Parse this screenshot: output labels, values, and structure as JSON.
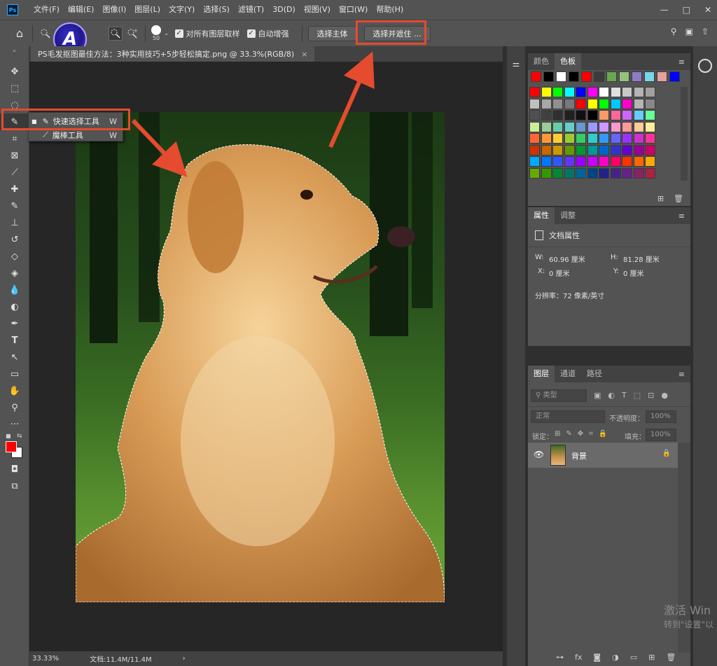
{
  "app": {
    "logo": "Ps"
  },
  "menu": [
    "文件(F)",
    "编辑(E)",
    "图像(I)",
    "图层(L)",
    "文字(Y)",
    "选择(S)",
    "滤镜(T)",
    "3D(D)",
    "视图(V)",
    "窗口(W)",
    "帮助(H)"
  ],
  "window_controls": {
    "minimize": "—",
    "restore": "□",
    "close": "✕"
  },
  "options": {
    "home_icon": "⌂",
    "brush_size": "50",
    "sample_all_layers_label": "对所有图层取样",
    "auto_enhance_label": "自动增强",
    "select_subject_label": "选择主体",
    "select_and_mask_label": "选择并遮住 ...",
    "badge_letter": "A"
  },
  "tab": {
    "title": "PS毛发抠图最佳方法：3种实用技巧+5步轻松搞定.png @ 33.3%(RGB/8)",
    "close": "×"
  },
  "flyout": {
    "item1": {
      "label": "快速选择工具",
      "key": "W"
    },
    "item2": {
      "label": "魔棒工具",
      "key": "W"
    }
  },
  "statusbar": {
    "zoom": "33.33%",
    "doc_info": "文档:11.4M/11.4M",
    "arrow": "›"
  },
  "color_panel": {
    "tabs": [
      "颜色",
      "色板"
    ],
    "active_tab": "色板"
  },
  "properties_panel": {
    "tabs": [
      "属性",
      "调整"
    ],
    "section_title": "文档属性",
    "w_label": "W:",
    "w_value": "60.96 厘米",
    "h_label": "H:",
    "h_value": "81.28 厘米",
    "x_label": "X:",
    "x_value": "0 厘米",
    "y_label": "Y:",
    "y_value": "0 厘米",
    "resolution": "分辨率：72 像素/英寸"
  },
  "layers_panel": {
    "tabs": [
      "图层",
      "通道",
      "路径"
    ],
    "filter_placeholder": "类型",
    "blend_mode": "正常",
    "opacity_label": "不透明度：",
    "opacity_value": "100%",
    "lock_label": "锁定：",
    "fill_label": "填充：",
    "fill_value": "100%",
    "layer_name": "背景"
  },
  "watermark": {
    "line1": "激活 Win",
    "line2": "转到\"设置\"以"
  },
  "colors": {
    "accent_red": "#e54b2e",
    "panel_bg": "#535353",
    "canvas_bg": "#262626"
  }
}
